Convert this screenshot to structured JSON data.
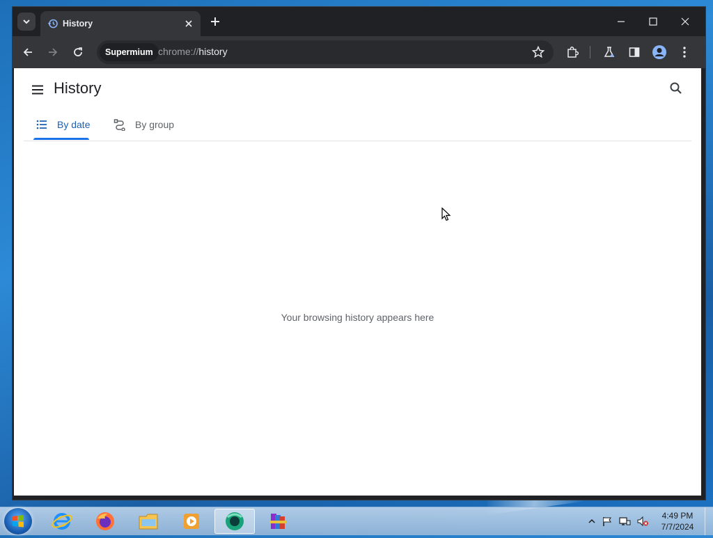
{
  "browser": {
    "tab": {
      "title": "History",
      "favicon": "history-icon"
    },
    "omnibox": {
      "chip": "Supermium",
      "scheme": "chrome://",
      "host": "history"
    }
  },
  "page": {
    "title": "History",
    "tabs": [
      {
        "label": "By date",
        "icon": "list-icon",
        "selected": true
      },
      {
        "label": "By group",
        "icon": "group-icon",
        "selected": false
      }
    ],
    "empty_message": "Your browsing history appears here"
  },
  "taskbar": {
    "apps": [
      "internet-explorer",
      "firefox",
      "file-explorer",
      "media-player",
      "supermium",
      "winrar"
    ],
    "clock": {
      "time": "4:49 PM",
      "date": "7/7/2024"
    }
  },
  "colors": {
    "accent": "#1a73e8",
    "titlebar": "#202124",
    "toolbar": "#35363a"
  }
}
